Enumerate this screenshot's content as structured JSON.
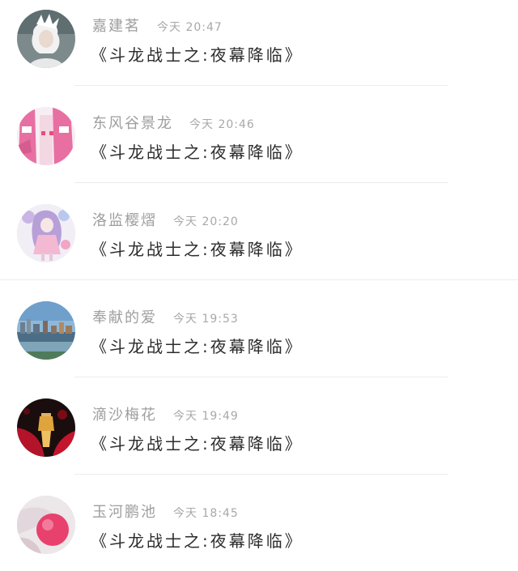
{
  "messages": [
    {
      "name": "嘉建茗",
      "time": "今天 20:47",
      "text": "《斗龙战士之:夜幕降临》",
      "avatar": "avatar-white-hair"
    },
    {
      "name": "东风谷景龙",
      "time": "今天 20:46",
      "text": "《斗龙战士之:夜幕降临》",
      "avatar": "avatar-pink-anime"
    },
    {
      "name": "洛监樱熠",
      "time": "今天 20:20",
      "text": "《斗龙战士之:夜幕降临》",
      "avatar": "avatar-anime-girl"
    },
    {
      "name": "奉献的爱",
      "time": "今天 19:53",
      "text": "《斗龙战士之:夜幕降临》",
      "avatar": "avatar-city"
    },
    {
      "name": "滴沙梅花",
      "time": "今天 19:49",
      "text": "《斗龙战士之:夜幕降临》",
      "avatar": "avatar-red-lantern"
    },
    {
      "name": "玉河鹏池",
      "time": "今天 18:45",
      "text": "《斗龙战士之:夜幕降临》",
      "avatar": "avatar-pink-ball"
    }
  ]
}
